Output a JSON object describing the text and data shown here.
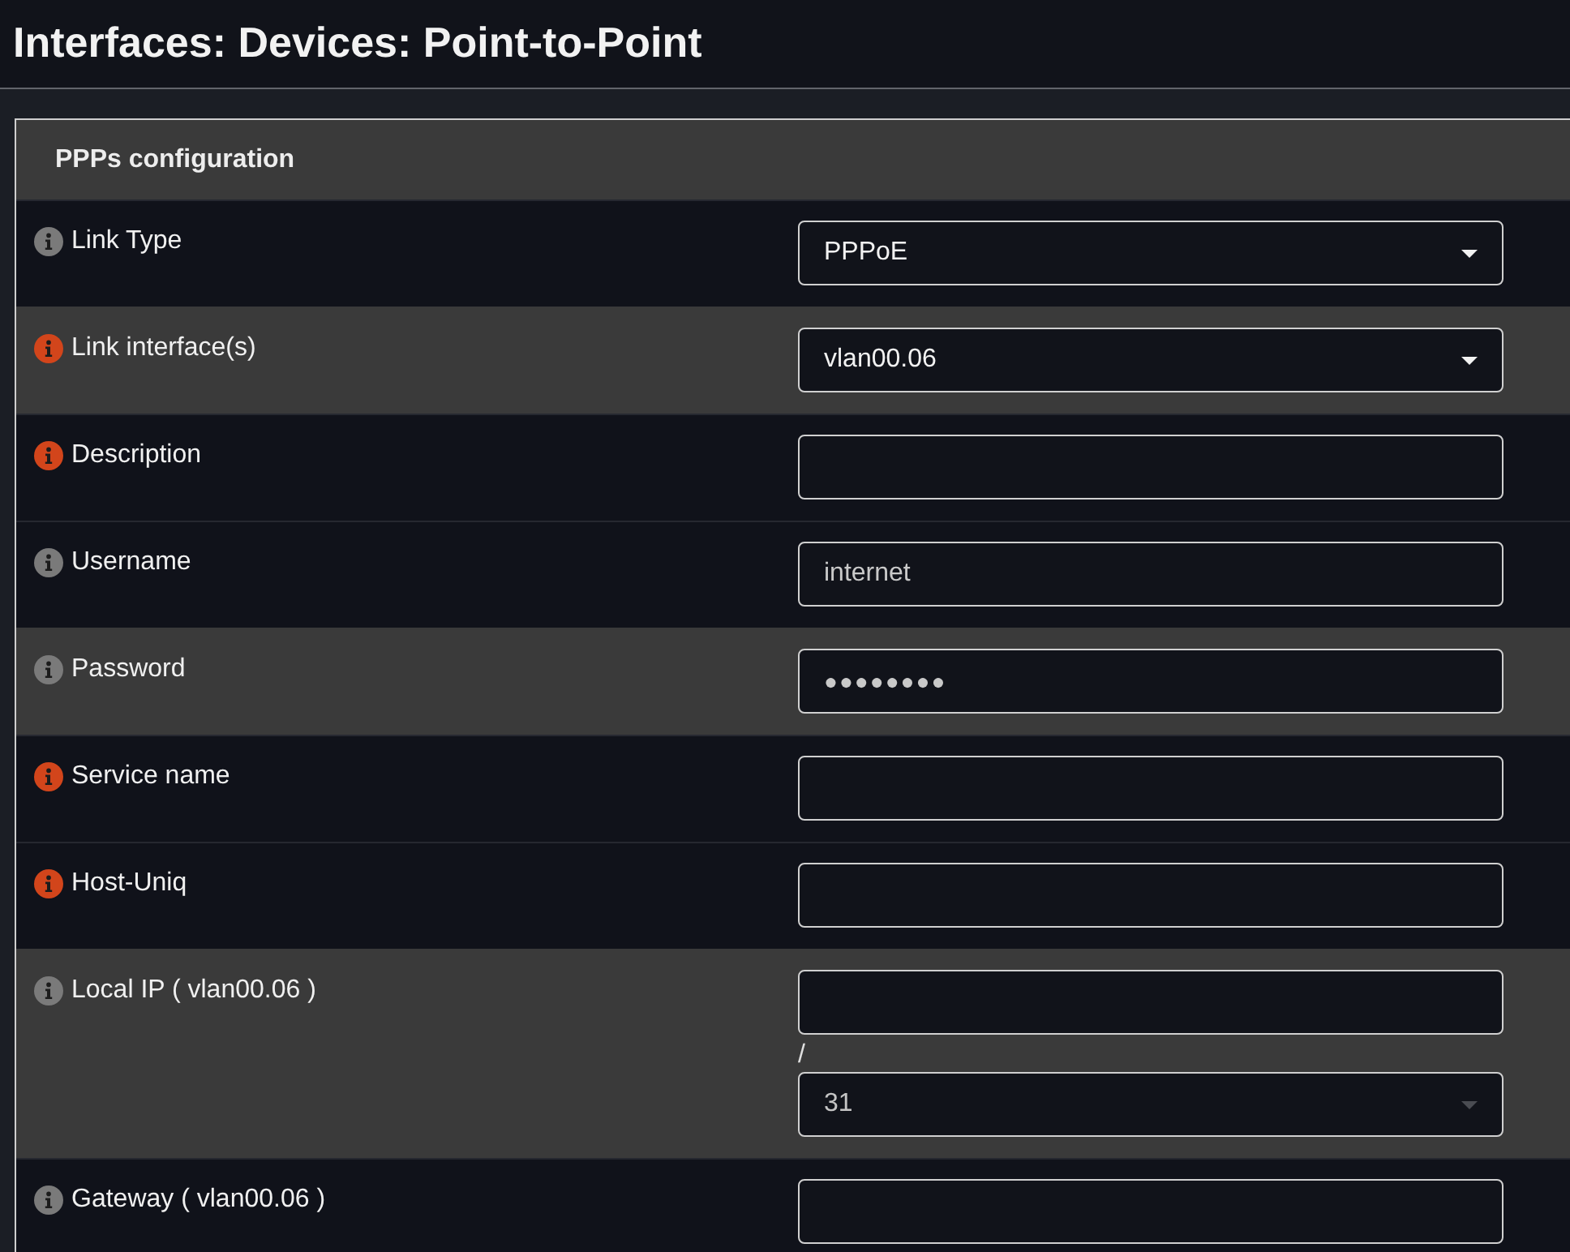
{
  "page": {
    "title": "Interfaces: Devices: Point-to-Point"
  },
  "panel": {
    "title": "PPPs configuration",
    "rows": [
      {
        "label": "Link Type",
        "color": "#7a7a7a",
        "shaded": false,
        "field": {
          "kind": "select",
          "value": "PPPoE"
        }
      },
      {
        "label": "Link interface(s)",
        "color": "#d2451b",
        "shaded": true,
        "field": {
          "kind": "select",
          "value": "vlan00.06"
        }
      },
      {
        "label": "Description",
        "color": "#d2451b",
        "shaded": false,
        "field": {
          "kind": "text"
        }
      },
      {
        "label": "Username",
        "color": "#7a7a7a",
        "shaded": false,
        "field": {
          "kind": "text",
          "value": "internet"
        }
      },
      {
        "label": "Password",
        "color": "#7a7a7a",
        "shaded": true,
        "field": {
          "kind": "password",
          "value": "●●●●●●●●"
        }
      },
      {
        "label": "Service name",
        "color": "#d2451b",
        "shaded": false,
        "field": {
          "kind": "text"
        }
      },
      {
        "label": "Host-Uniq",
        "color": "#d2451b",
        "shaded": false,
        "field": {
          "kind": "text"
        }
      },
      {
        "label": "Local IP ( vlan00.06 )",
        "color": "#7a7a7a",
        "shaded": true,
        "field": {
          "kind": "ip_subnet",
          "separator": "/",
          "mask": "31"
        }
      },
      {
        "label": "Gateway ( vlan00.06 )",
        "color": "#7a7a7a",
        "shaded": false,
        "field": {
          "kind": "text"
        }
      }
    ]
  }
}
